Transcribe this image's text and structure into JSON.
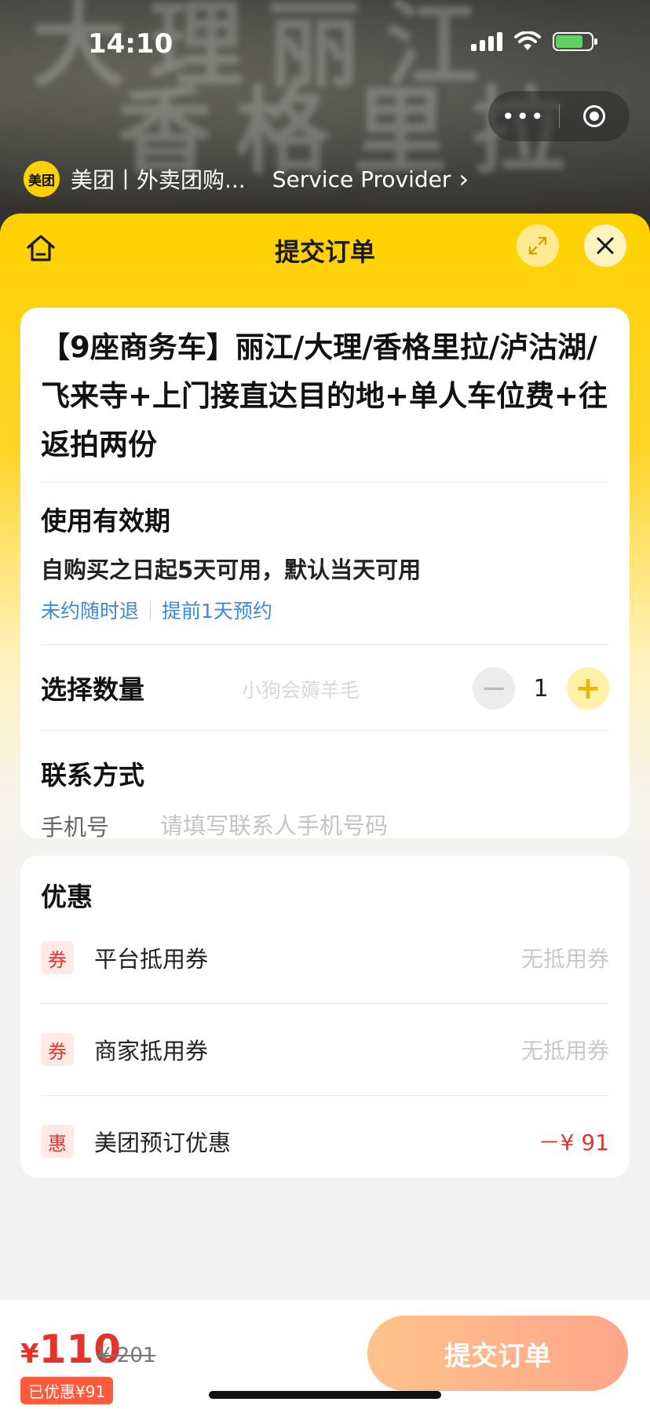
{
  "status_bar": {
    "time": "14:10"
  },
  "mini_app": {
    "provider_logo_text": "美团",
    "provider_name": "美团丨外卖团购...",
    "service_provider": "Service Provider",
    "chevron": "›",
    "capsule_more": "•••"
  },
  "header": {
    "title": "提交订单"
  },
  "product": {
    "title": "【9座商务车】丽江/大理/香格里拉/泸沽湖/飞来寺+上门接直达目的地+单人车位费+往返拍两份",
    "validity_label": "使用有效期",
    "validity_text": "自购买之日起5天可用，默认当天可用",
    "tags": [
      "未约随时退",
      "提前1天预约"
    ]
  },
  "quantity": {
    "label": "选择数量",
    "value": "1",
    "minus": "−",
    "plus": "+",
    "watermark": "小狗会薅羊毛"
  },
  "contact": {
    "label": "联系方式",
    "phone_label": "手机号",
    "phone_placeholder": "请填写联系人手机号码"
  },
  "promotions": {
    "title": "优惠",
    "items": [
      {
        "badge": "券",
        "name": "平台抵用券",
        "value": "无抵用券"
      },
      {
        "badge": "券",
        "name": "商家抵用券",
        "value": "无抵用券"
      },
      {
        "badge": "惠",
        "name": "美团预订优惠",
        "value": "－¥ 91"
      }
    ]
  },
  "footer": {
    "currency": "¥",
    "price": "110",
    "original_price": "¥ 201",
    "saved": "已优惠¥91",
    "submit_label": "提交订单"
  },
  "colors": {
    "brand_yellow": "#ffd100",
    "price_red": "#e5332a",
    "link_blue": "#3a8ad8",
    "submit_gradient_start": "#ffc38a",
    "submit_gradient_end": "#ffa58a"
  }
}
